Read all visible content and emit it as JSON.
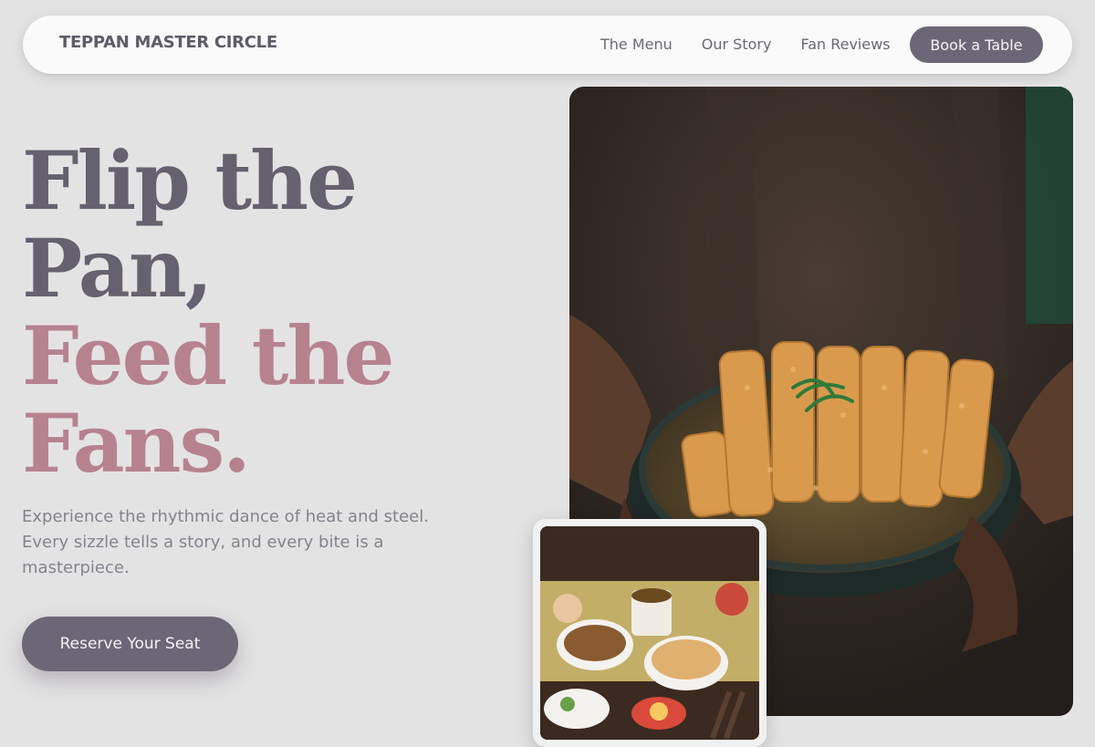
{
  "nav": {
    "brand": "TEPPAN MASTER CIRCLE",
    "links": [
      "The Menu",
      "Our Story",
      "Fan Reviews"
    ],
    "cta": "Book a Table"
  },
  "hero": {
    "title_line_1": "Flip the",
    "title_line_2": "Pan,",
    "title_line_3": "Feed the",
    "title_line_4": "Fans.",
    "subtitle": "Experience the rhythmic dance of heat and steel. Every sizzle tells a story, and every bite is a masterpiece.",
    "cta": "Reserve Your Seat"
  },
  "colors": {
    "background": "#e4e3e4",
    "primary": "#6c6776",
    "title_dark": "#66616e",
    "title_accent": "#b78290"
  },
  "images": {
    "main": "photo-person-holding-katsu-bowl",
    "secondary": "photo-japanese-table-spread"
  }
}
